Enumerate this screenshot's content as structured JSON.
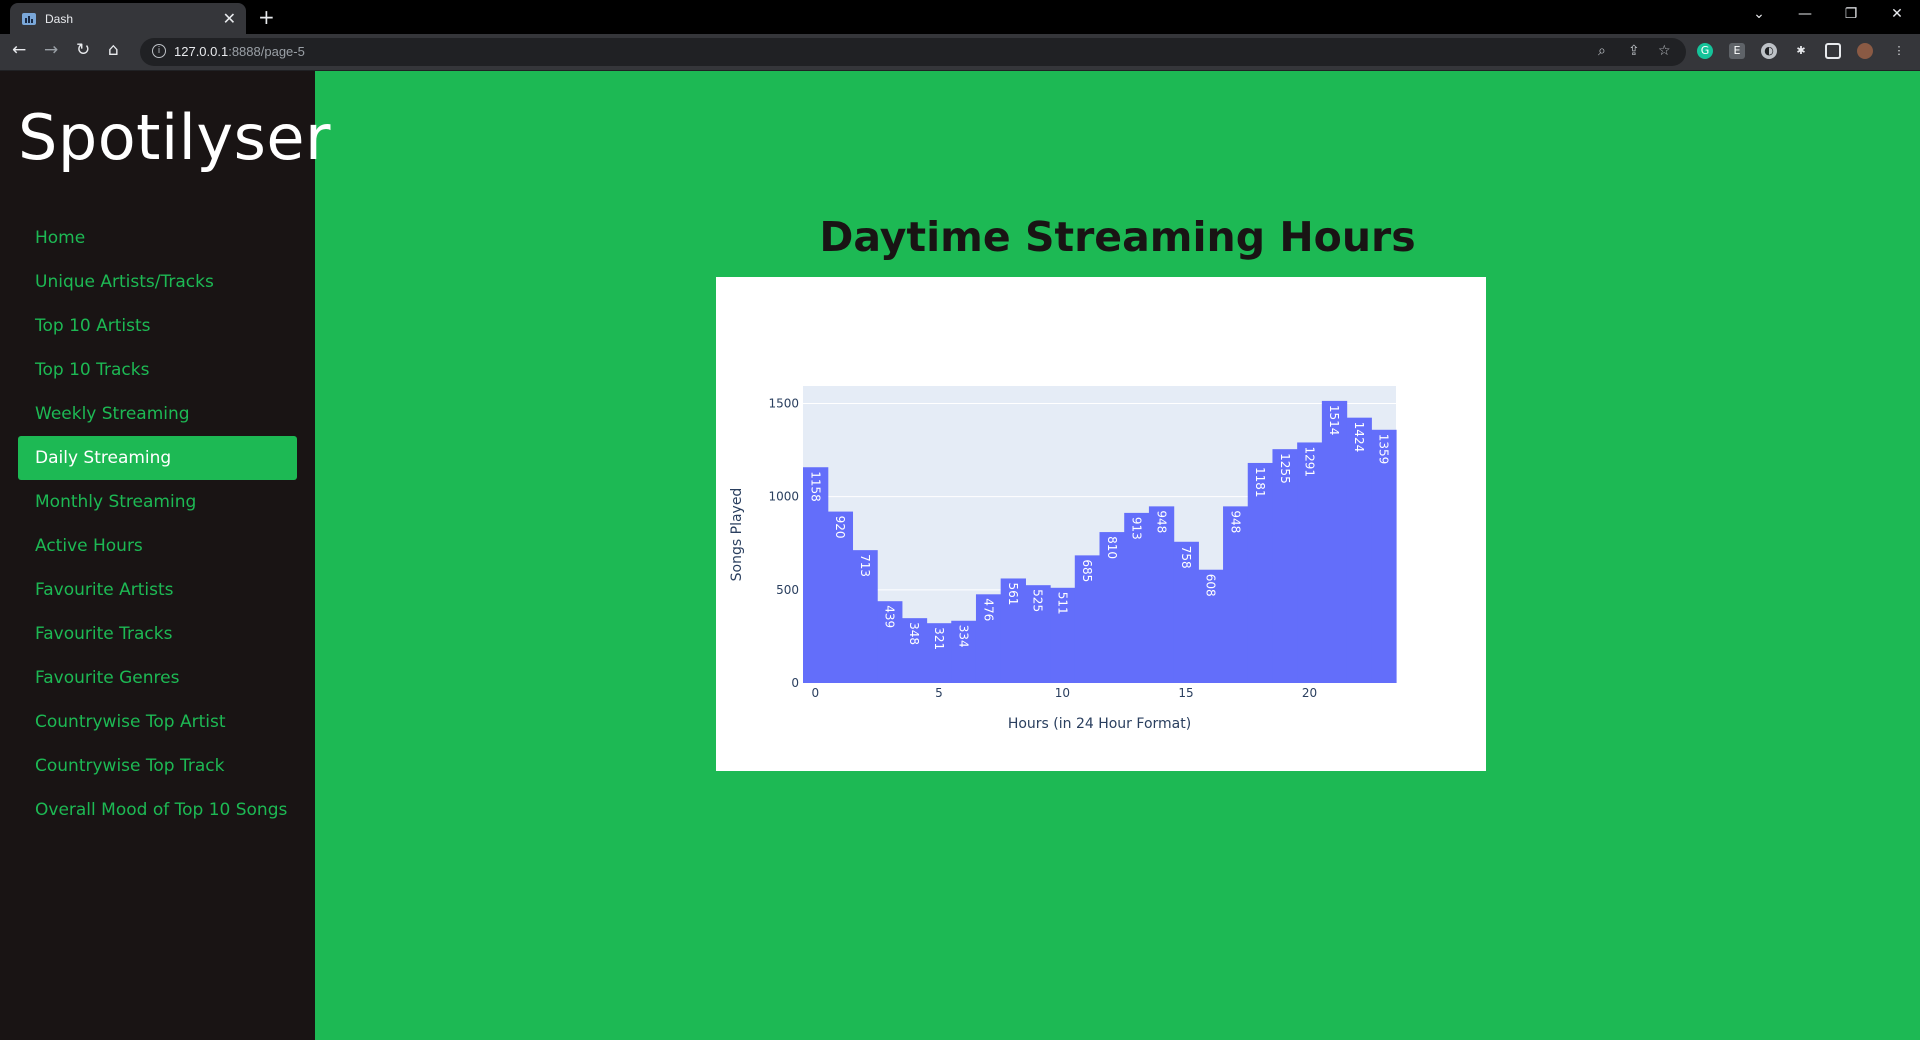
{
  "browser": {
    "tab_title": "Dash",
    "url_host": "127.0.0.1",
    "url_rest": ":8888/page-5"
  },
  "sidebar": {
    "brand": "Spotilyser",
    "items": [
      {
        "label": "Home",
        "active": false
      },
      {
        "label": "Unique Artists/Tracks",
        "active": false
      },
      {
        "label": "Top 10 Artists",
        "active": false
      },
      {
        "label": "Top 10 Tracks",
        "active": false
      },
      {
        "label": "Weekly Streaming",
        "active": false
      },
      {
        "label": "Daily Streaming",
        "active": true
      },
      {
        "label": "Monthly Streaming",
        "active": false
      },
      {
        "label": "Active Hours",
        "active": false
      },
      {
        "label": "Favourite Artists",
        "active": false
      },
      {
        "label": "Favourite Tracks",
        "active": false
      },
      {
        "label": "Favourite Genres",
        "active": false
      },
      {
        "label": "Countrywise Top Artist",
        "active": false
      },
      {
        "label": "Countrywise Top Track",
        "active": false
      },
      {
        "label": "Overall Mood of Top 10 Songs",
        "active": false
      }
    ]
  },
  "main": {
    "title": "Daytime Streaming Hours"
  },
  "colors": {
    "accent": "#1db954",
    "sidebar_bg": "#191414",
    "bar": "#636efa",
    "plot_bg": "#e5ecf6"
  },
  "chart_data": {
    "type": "bar",
    "x": [
      0,
      1,
      2,
      3,
      4,
      5,
      6,
      7,
      8,
      9,
      10,
      11,
      12,
      13,
      14,
      15,
      16,
      17,
      18,
      19,
      20,
      21,
      22,
      23
    ],
    "values": [
      1158,
      920,
      713,
      439,
      348,
      321,
      334,
      476,
      561,
      525,
      511,
      685,
      810,
      913,
      948,
      758,
      608,
      948,
      1181,
      1255,
      1291,
      1514,
      1424,
      1359
    ],
    "data_labels": true,
    "xlabel": "Hours (in 24 Hour Format)",
    "ylabel": "Songs Played",
    "xticks": [
      0,
      5,
      10,
      15,
      20
    ],
    "yticks": [
      0,
      500,
      1000,
      1500
    ],
    "ylim": [
      0,
      1594
    ],
    "grid": true
  }
}
